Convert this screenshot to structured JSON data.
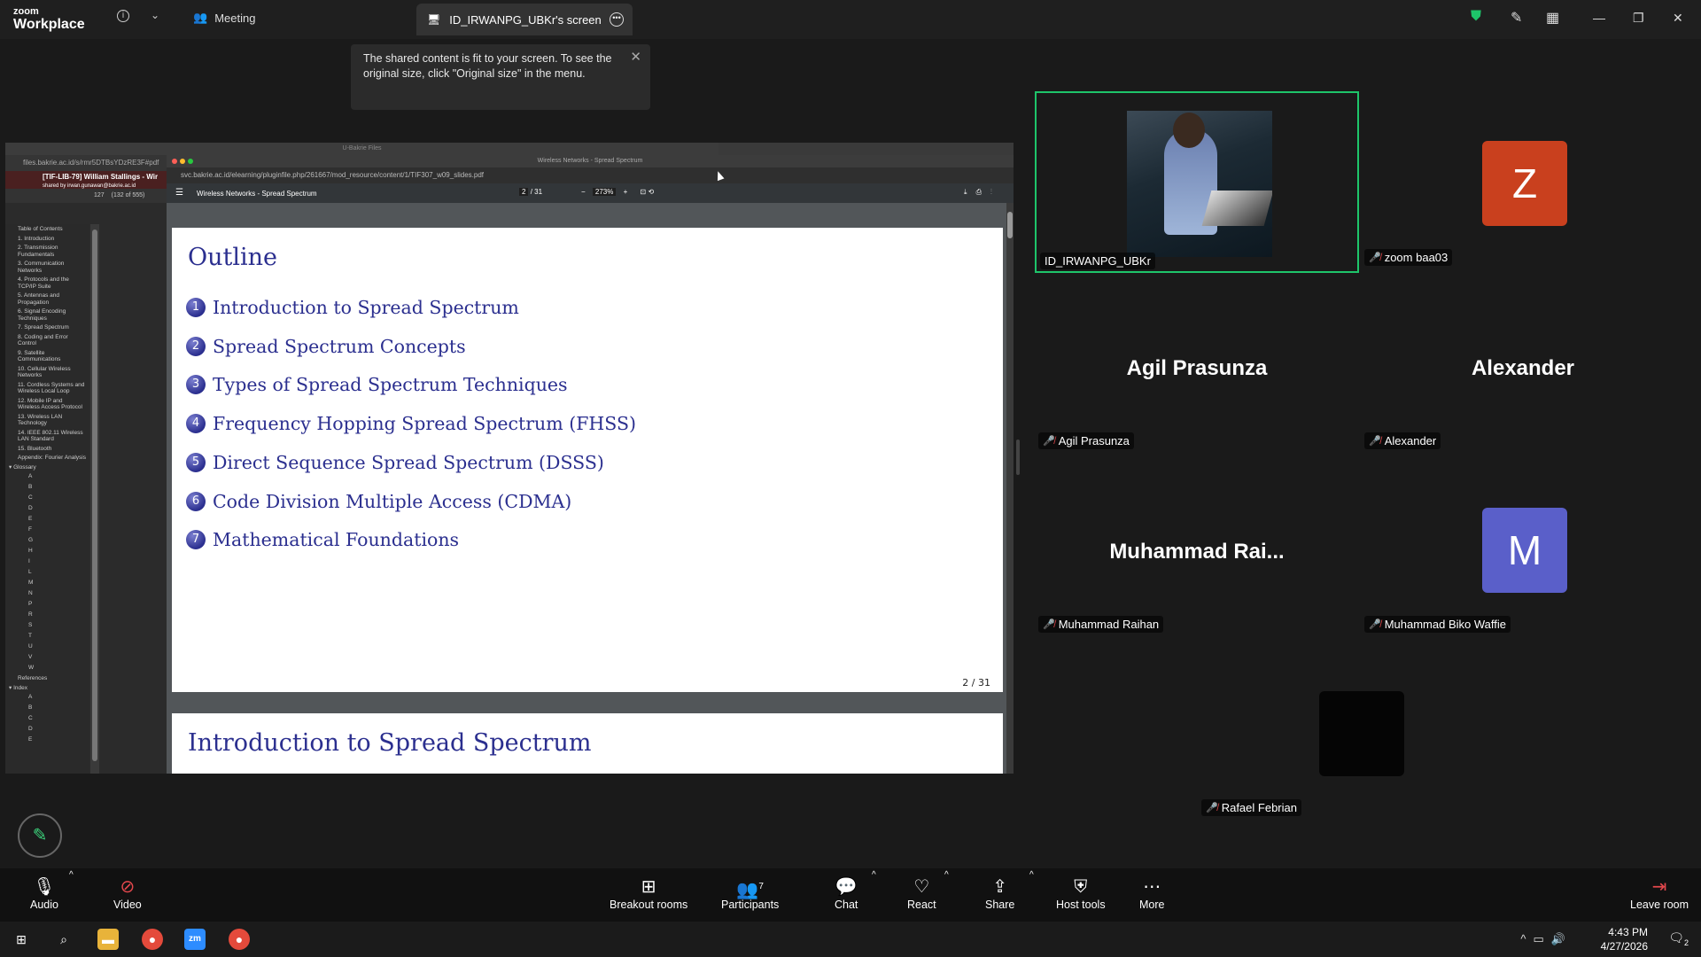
{
  "app": {
    "brand_top": "zoom",
    "brand_bottom": "Workplace",
    "meeting_label": "Meeting",
    "screen_tab": "ID_IRWANPG_UBKr's screen"
  },
  "tooltip": {
    "text": "The shared content is fit to your screen. To see the original size, click \"Original size\" in the menu."
  },
  "shared_screen": {
    "back_window": {
      "title": "U-Bakrie Files",
      "url": "files.bakrie.ac.id/s/rmr5DTBsYDzRE3F#pdf",
      "tab_title": "[TIF-LIB-79] William Stallings - Wir",
      "tab_sub": "shared by irwan.gunawan@bakrie.ac.id",
      "page_field": "127",
      "page_count": "(132 of 555)",
      "toc": [
        "Table of Contents",
        "1. Introduction",
        "2. Transmission Fundamentals",
        "3. Communication Networks",
        "4. Protocols and the TCP/IP Suite",
        "5. Antennas and Propagation",
        "6. Signal Encoding Techniques",
        "7. Spread Spectrum",
        "8. Coding and Error Control",
        "9. Satellite Communications",
        "10. Cellular Wireless Networks",
        "11. Cordless Systems and Wireless Local Loop",
        "12. Mobile IP and Wireless Access Protocol",
        "13. Wireless LAN Technology",
        "14. IEEE 802.11 Wireless LAN Standard",
        "15. Bluetooth",
        "Appendix: Fourier Analysis"
      ],
      "glossary_label": "Glossary",
      "glossary_letters": [
        "A",
        "B",
        "C",
        "D",
        "E",
        "F",
        "G",
        "H",
        "I",
        "L",
        "M",
        "N",
        "P",
        "R",
        "S",
        "T",
        "U",
        "V",
        "W"
      ],
      "references_label": "References",
      "index_label": "Index",
      "index_letters": [
        "A",
        "B",
        "C",
        "D",
        "E"
      ]
    },
    "front_window": {
      "title": "Wireless Networks - Spread Spectrum",
      "url": "svc.bakrie.ac.id/elearning/pluginfile.php/261667/mod_resource/content/1/TIF307_w09_slides.pdf",
      "pdf_title": "Wireless Networks - Spread Spectrum",
      "page_current": "2",
      "page_total": "/ 31",
      "zoom": "273%"
    },
    "slide": {
      "title": "Outline",
      "items": [
        {
          "num": "1",
          "text": "Introduction to Spread Spectrum"
        },
        {
          "num": "2",
          "text": "Spread Spectrum Concepts"
        },
        {
          "num": "3",
          "text": "Types of Spread Spectrum Techniques"
        },
        {
          "num": "4",
          "text": "Frequency Hopping Spread Spectrum (FHSS)"
        },
        {
          "num": "5",
          "text": "Direct Sequence Spread Spectrum (DSSS)"
        },
        {
          "num": "6",
          "text": "Code Division Multiple Access (CDMA)"
        },
        {
          "num": "7",
          "text": "Mathematical Foundations"
        }
      ],
      "page_number": "2 / 31"
    },
    "next_slide": {
      "title": "Introduction to Spread Spectrum"
    }
  },
  "participants": [
    {
      "name": "ID_IRWANPG_UBKr",
      "type": "video",
      "active": true
    },
    {
      "name": "zoom baa03",
      "type": "avatar",
      "initial": "Z",
      "color": "#c9401e",
      "muted": true
    },
    {
      "name": "Agil Prasunza",
      "type": "name",
      "display": "Agil Prasunza",
      "muted": true
    },
    {
      "name": "Alexander",
      "type": "name",
      "display": "Alexander",
      "muted": true
    },
    {
      "name": "Muhammad Raihan",
      "type": "name",
      "display": "Muhammad  Rai...",
      "muted": true
    },
    {
      "name": "Muhammad Biko Waffie",
      "type": "avatar",
      "initial": "M",
      "color": "#5a5fc9",
      "muted": true
    },
    {
      "name": "Rafael Febrian",
      "type": "blank",
      "muted": true
    }
  ],
  "toolbar": {
    "audio": "Audio",
    "video": "Video",
    "breakout": "Breakout rooms",
    "participants": "Participants",
    "participants_count": "7",
    "chat": "Chat",
    "react": "React",
    "share": "Share",
    "host_tools": "Host tools",
    "more": "More",
    "leave": "Leave room"
  },
  "taskbar": {
    "time": "4:43 PM",
    "date": "4/27/2026",
    "notifications": "2"
  },
  "colors": {
    "accent_green": "#1ec56a",
    "mute_red": "#e5484d",
    "slide_blue": "#2b2f8f"
  }
}
